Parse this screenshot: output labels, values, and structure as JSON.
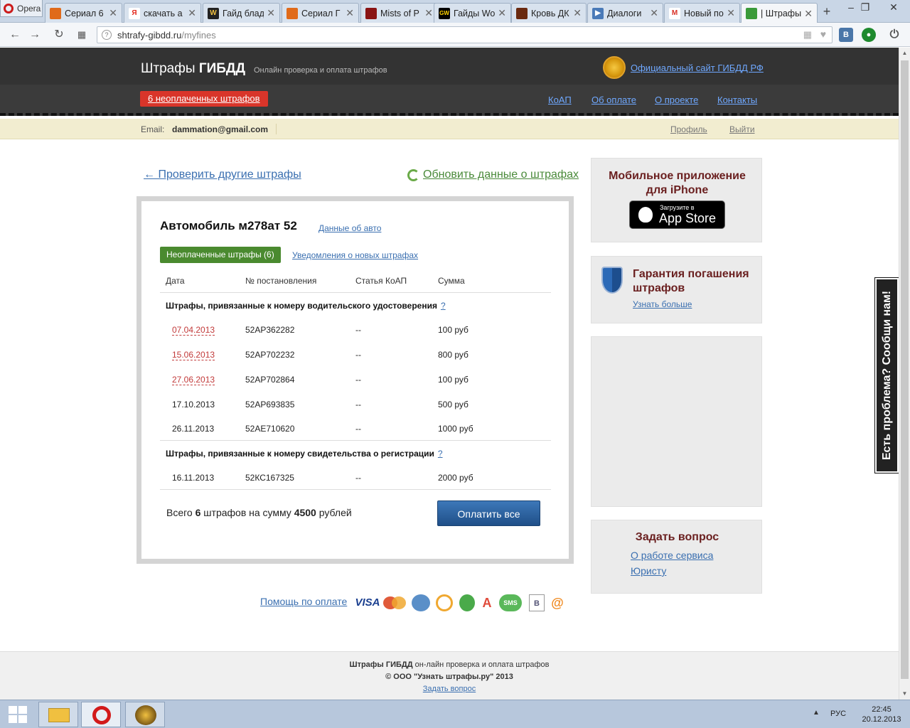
{
  "browser": {
    "app_name": "Opera",
    "tabs": [
      {
        "label": "Сериал 6"
      },
      {
        "label": "скачать а"
      },
      {
        "label": "Гайд блад"
      },
      {
        "label": "Сериал Г"
      },
      {
        "label": "Mists of P"
      },
      {
        "label": "Гайды Wo"
      },
      {
        "label": "Кровь ДК"
      },
      {
        "label": "Диалоги"
      },
      {
        "label": "Новый по"
      },
      {
        "label": "| Штрафы"
      }
    ],
    "url_host": "shtrafy-gibdd.ru",
    "url_path": "/myfines"
  },
  "site": {
    "logo_plain": "Штрафы ",
    "logo_bold": "ГИБДД",
    "tagline": "Онлайн проверка и оплата штрафов",
    "official_link": "Официальный сайт ГИБДД РФ",
    "unpaid_button": "6 неоплаченных штрафов",
    "nav": [
      "КоАП",
      "Об оплате",
      "О проекте",
      "Контакты"
    ],
    "email_label": "Email:",
    "email": "dammation@gmail.com",
    "profile_link": "Профиль",
    "logout_link": "Выйти"
  },
  "main": {
    "back_link": "← Проверить другие штрафы",
    "refresh_link": "Обновить данные о штрафах",
    "car_title": "Автомобиль м278ат 52",
    "car_data_link": "Данные об авто",
    "tab_unpaid": "Неоплаченные штрафы (6)",
    "tab_notify": "Уведомления о новых штрафах",
    "columns": [
      "Дата",
      "№ постановления",
      "Статья КоАП",
      "Сумма"
    ],
    "section1_title": "Штрафы, привязанные к номеру водительского удостоверения",
    "section2_title": "Штрафы, привязанные к номеру свидетельства о регистрации",
    "help_mark": "?",
    "fines_license": [
      {
        "date": "07.04.2013",
        "number": "52АР362282",
        "article": "--",
        "amount": "100 руб"
      },
      {
        "date": "15.06.2013",
        "number": "52АР702232",
        "article": "--",
        "amount": "800 руб"
      },
      {
        "date": "27.06.2013",
        "number": "52АР702864",
        "article": "--",
        "amount": "100 руб"
      },
      {
        "date": "17.10.2013",
        "number": "52АР693835",
        "article": "--",
        "amount": "500 руб"
      },
      {
        "date": "26.11.2013",
        "number": "52АЕ710620",
        "article": "--",
        "amount": "1000 руб"
      }
    ],
    "fines_registration": [
      {
        "date": "16.11.2013",
        "number": "52КС167325",
        "article": "--",
        "amount": "2000 руб"
      }
    ],
    "total_prefix": "Всего ",
    "total_count": "6",
    "total_mid": " штрафов на сумму ",
    "total_sum": "4500",
    "total_suffix": " рублей",
    "pay_all": "Оплатить все",
    "help_payment": "Помощь по оплате",
    "payment_icons": [
      "visa-icon",
      "mastercard-icon",
      "webmoney-icon",
      "qiwi-icon",
      "sberbank-icon",
      "alfabank-icon",
      "sms-icon",
      "vkontakte-icon",
      "mailru-icon"
    ],
    "pay_visa_text": "VISA",
    "pay_sms_text": "SMS"
  },
  "sidebar": {
    "app_title": "Мобильное приложение для iPhone",
    "appstore_small": "Загрузите в",
    "appstore_big": "App Store",
    "guarantee_title": "Гарантия погашения штрафов",
    "guarantee_link": "Узнать больше",
    "ask_title": "Задать вопрос",
    "ask_link1": "О работе сервиса",
    "ask_link2": "Юристу",
    "feedback_tab": "Есть проблема? Сообщи нам!"
  },
  "footer": {
    "line1_bold": "Штрафы ГИБДД",
    "line1_rest": " он-лайн проверка и оплата штрафов",
    "line2": "© ООО \"Узнать штрафы.ру\" 2013",
    "line3": "Задать вопрос"
  },
  "taskbar": {
    "lang": "РУС",
    "time": "22:45",
    "date": "20.12.2013"
  },
  "colors": {
    "header_dark": "#333333",
    "alert_red": "#d9352a",
    "tab_green": "#4a8a2f",
    "link_blue": "#3a6fb0",
    "pay_button": "#2a5f9e",
    "sidebar_title": "#6a1f1f"
  }
}
